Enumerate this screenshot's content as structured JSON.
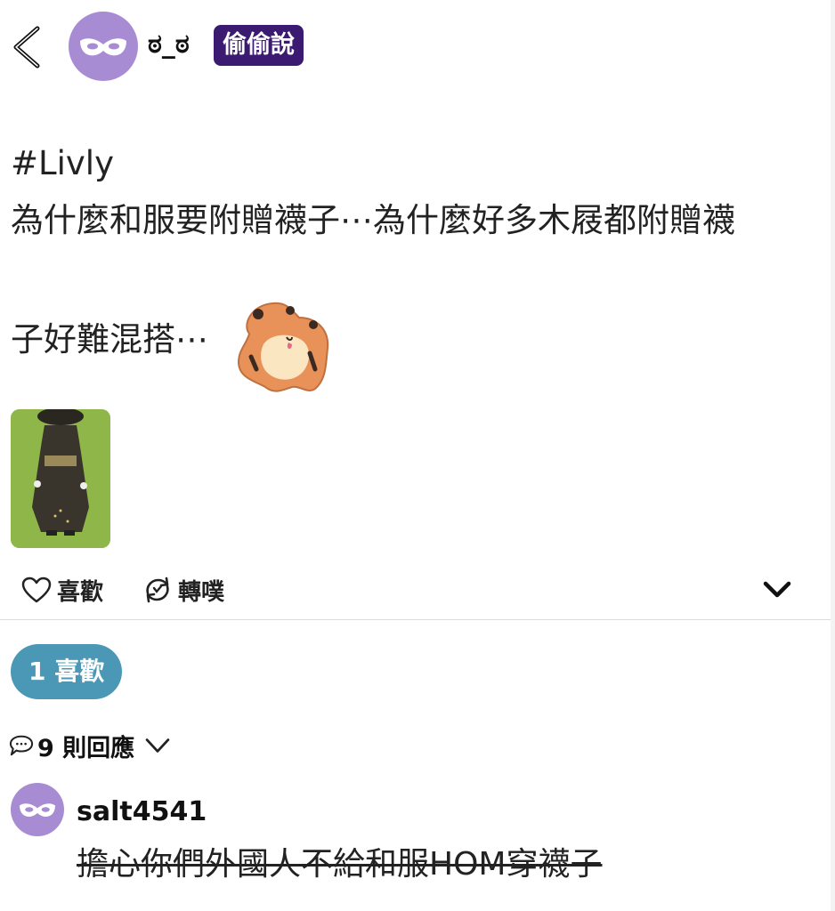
{
  "header": {
    "username": "ಠ_ಠ",
    "badge": "偷偷說"
  },
  "post": {
    "hashtag": "#Livly",
    "line1": "為什麼和服要附贈襪子⋯為什麼好多木屐都附贈襪",
    "line2": "子好難混搭⋯",
    "sticker_icon": "hamster-sticker",
    "image_icon": "kimono-avatar-thumbnail"
  },
  "actions": {
    "like_label": "喜歡",
    "replurk_label": "轉噗"
  },
  "stats": {
    "likes_label": "1 喜歡",
    "replies_label": "9 則回應"
  },
  "reply": {
    "username": "salt4541",
    "text": "擔心你們外國人不給和服HOM穿襪子"
  },
  "colors": {
    "avatar": "#a78bd3",
    "badge_bg": "#3b1a72",
    "likes_pill": "#4b98b6",
    "thumb_bg": "#8fb649"
  }
}
